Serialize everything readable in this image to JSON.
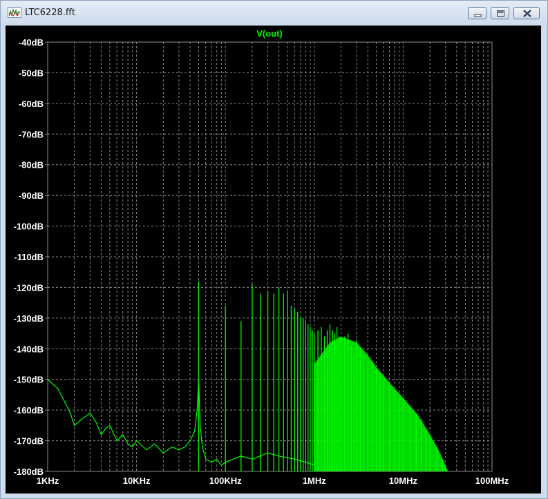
{
  "window": {
    "title": "LTC6228.fft",
    "app_icon": "waveform-viewer-icon",
    "controls": {
      "minimize_icon": "minimize-icon",
      "maximize_icon": "maximize-icon",
      "close_icon": "close-icon"
    }
  },
  "colors": {
    "trace": "#00ff00",
    "background": "#000000",
    "grid": "#8c8c8c",
    "text": "#ffffff",
    "frame": "#cfdcec"
  },
  "chart_data": {
    "type": "line",
    "title": "V(out)",
    "x_scale": "log",
    "xlim": [
      1000,
      100000000
    ],
    "ylim": [
      -180,
      -40
    ],
    "grid": true,
    "x_ticks": [
      {
        "value": 1000,
        "label": "1KHz"
      },
      {
        "value": 10000,
        "label": "10KHz"
      },
      {
        "value": 100000,
        "label": "100KHz"
      },
      {
        "value": 1000000,
        "label": "1MHz"
      },
      {
        "value": 10000000,
        "label": "10MHz"
      },
      {
        "value": 100000000,
        "label": "100MHz"
      }
    ],
    "y_ticks": [
      {
        "value": -40,
        "label": "-40dB"
      },
      {
        "value": -50,
        "label": "-50dB"
      },
      {
        "value": -60,
        "label": "-60dB"
      },
      {
        "value": -70,
        "label": "-70dB"
      },
      {
        "value": -80,
        "label": "-80dB"
      },
      {
        "value": -90,
        "label": "-90dB"
      },
      {
        "value": -100,
        "label": "-100dB"
      },
      {
        "value": -110,
        "label": "-110dB"
      },
      {
        "value": -120,
        "label": "-120dB"
      },
      {
        "value": -130,
        "label": "-130dB"
      },
      {
        "value": -140,
        "label": "-140dB"
      },
      {
        "value": -150,
        "label": "-150dB"
      },
      {
        "value": -160,
        "label": "-160dB"
      },
      {
        "value": -170,
        "label": "-170dB"
      },
      {
        "value": -180,
        "label": "-180dB"
      }
    ],
    "series": [
      {
        "name": "V(out)",
        "noise_floor": [
          [
            1000,
            -150
          ],
          [
            1300,
            -153
          ],
          [
            1600,
            -158
          ],
          [
            1800,
            -161
          ],
          [
            2000,
            -165
          ],
          [
            2400,
            -163
          ],
          [
            3000,
            -161
          ],
          [
            3500,
            -164
          ],
          [
            4000,
            -168
          ],
          [
            4500,
            -166
          ],
          [
            5000,
            -165
          ],
          [
            6000,
            -170
          ],
          [
            7000,
            -168
          ],
          [
            8000,
            -171
          ],
          [
            9000,
            -172
          ],
          [
            10000,
            -170
          ],
          [
            13000,
            -173
          ],
          [
            16000,
            -171
          ],
          [
            20000,
            -174
          ],
          [
            25000,
            -172
          ],
          [
            30000,
            -173
          ],
          [
            35000,
            -172
          ],
          [
            40000,
            -170
          ],
          [
            45000,
            -167
          ],
          [
            48000,
            -160
          ],
          [
            50000,
            -150
          ],
          [
            52000,
            -165
          ],
          [
            55000,
            -172
          ],
          [
            60000,
            -176
          ],
          [
            70000,
            -177
          ],
          [
            80000,
            -176
          ],
          [
            90000,
            -178
          ],
          [
            100000,
            -177
          ],
          [
            150000,
            -175
          ],
          [
            200000,
            -176
          ],
          [
            300000,
            -174
          ],
          [
            400000,
            -175
          ],
          [
            600000,
            -176
          ],
          [
            800000,
            -177
          ],
          [
            1000000,
            -178
          ]
        ],
        "peaks": [
          [
            50000,
            -118
          ],
          [
            100000,
            -126
          ],
          [
            150000,
            -131
          ],
          [
            200000,
            -119
          ],
          [
            250000,
            -122
          ],
          [
            300000,
            -121
          ],
          [
            350000,
            -122
          ],
          [
            400000,
            -120
          ],
          [
            450000,
            -122
          ],
          [
            500000,
            -121
          ],
          [
            550000,
            -126
          ],
          [
            600000,
            -127
          ],
          [
            650000,
            -128
          ],
          [
            700000,
            -130
          ],
          [
            750000,
            -130
          ],
          [
            800000,
            -131
          ],
          [
            850000,
            -132
          ],
          [
            900000,
            -133
          ],
          [
            950000,
            -134
          ],
          [
            1000000,
            -135
          ],
          [
            1100000,
            -134
          ],
          [
            1200000,
            -133
          ],
          [
            1300000,
            -136
          ],
          [
            1400000,
            -134
          ],
          [
            1500000,
            -132
          ],
          [
            1600000,
            -134
          ],
          [
            1700000,
            -135
          ],
          [
            1800000,
            -133
          ],
          [
            1900000,
            -136
          ],
          [
            2000000,
            -137
          ],
          [
            2200000,
            -136
          ],
          [
            2400000,
            -135
          ],
          [
            2600000,
            -139
          ],
          [
            2800000,
            -141
          ],
          [
            3000000,
            -137
          ],
          [
            3300000,
            -140
          ],
          [
            3600000,
            -142
          ],
          [
            4000000,
            -145
          ],
          [
            4500000,
            -144
          ],
          [
            5000000,
            -147
          ],
          [
            5500000,
            -148
          ],
          [
            6000000,
            -150
          ],
          [
            7000000,
            -152
          ],
          [
            8000000,
            -154
          ],
          [
            9000000,
            -156
          ],
          [
            10000000,
            -157
          ],
          [
            12000000,
            -159
          ],
          [
            14000000,
            -161
          ],
          [
            16000000,
            -163
          ],
          [
            18000000,
            -166
          ],
          [
            20000000,
            -168
          ],
          [
            24000000,
            -172
          ],
          [
            28000000,
            -176
          ],
          [
            32000000,
            -180
          ]
        ],
        "envelope": [
          [
            1000000,
            -145
          ],
          [
            1500000,
            -138
          ],
          [
            2000000,
            -136
          ],
          [
            3000000,
            -138
          ],
          [
            4000000,
            -142
          ],
          [
            5000000,
            -146
          ],
          [
            7000000,
            -151
          ],
          [
            10000000,
            -156
          ],
          [
            15000000,
            -162
          ],
          [
            20000000,
            -168
          ],
          [
            25000000,
            -173
          ],
          [
            32000000,
            -180
          ]
        ]
      }
    ]
  }
}
